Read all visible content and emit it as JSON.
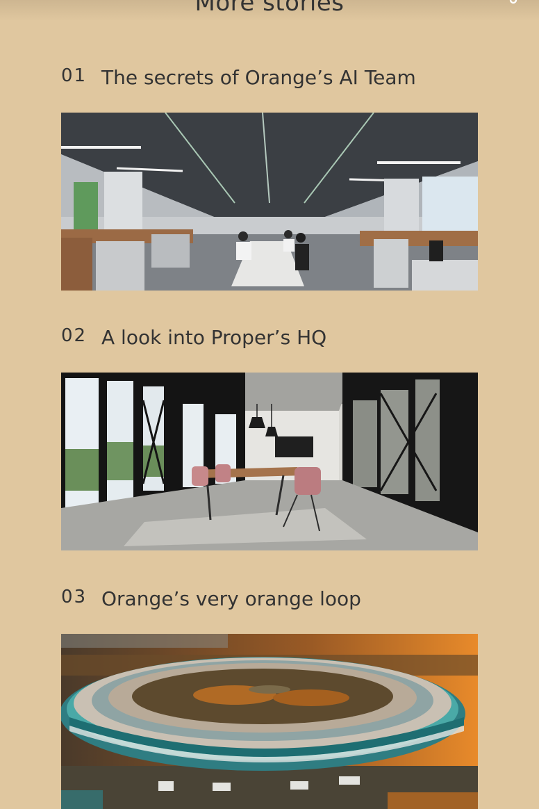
{
  "section": {
    "title": "More stories"
  },
  "stories": [
    {
      "number": "01",
      "title": "The secrets of Orange’s AI Team",
      "image_icon": "office-photo"
    },
    {
      "number": "02",
      "title": "A look into Proper’s HQ",
      "image_icon": "meeting-room-photo"
    },
    {
      "number": "03",
      "title": "Orange’s very orange loop",
      "image_icon": "ring-campus-photo"
    }
  ],
  "colors": {
    "background": "#e0c79f",
    "text": "#333333"
  }
}
